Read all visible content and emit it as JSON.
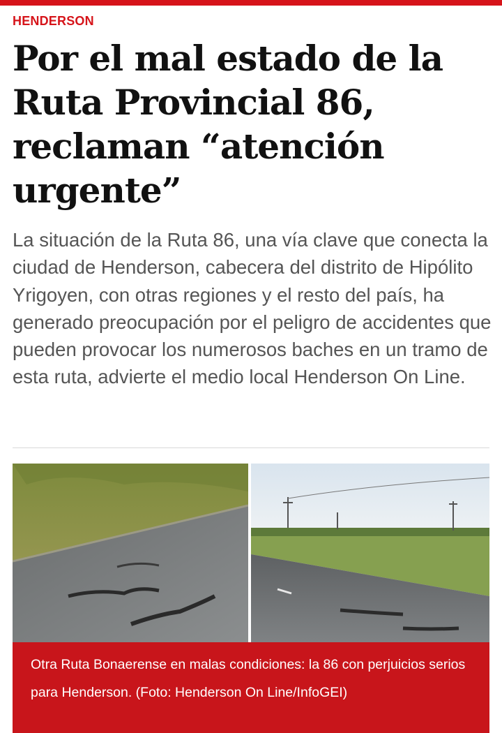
{
  "article": {
    "section": "HENDERSON",
    "headline": "Por el mal estado de la Ruta Provincial 86, reclaman “atención urgente”",
    "lead": "La situación de la Ruta 86, una vía clave que conecta la ciudad de Henderson, cabecera del distrito de Hipólito Yrigoyen, con otras regiones y el resto del país, ha generado preocupación por el peligro de accidentes que pueden provocar los numerosos baches en un tramo de esta ruta, advierte el medio local Henderson On Line.",
    "photo_caption": "Otra Ruta Bonaerense en malas condiciones: la 86 con perjuicios serios para Henderson. (Foto: Henderson On Line/InfoGEI)"
  },
  "colors": {
    "accent": "#d6141a",
    "caption_bg": "#c8151b",
    "headline": "#111111",
    "lead": "#555555"
  }
}
